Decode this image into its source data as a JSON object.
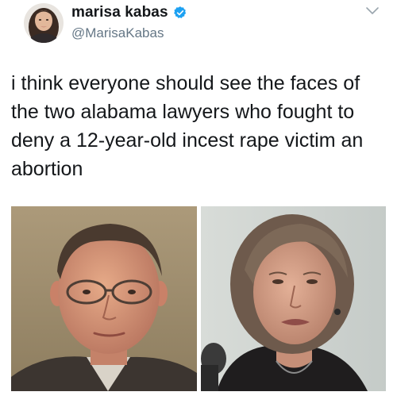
{
  "author": {
    "display_name": "marisa kabas",
    "handle": "@MarisaKabas",
    "verified": true,
    "verified_color": "#1da1f2"
  },
  "menu_icon": "chevron-down-icon",
  "tweet": {
    "text": "i think everyone should see the faces of the two alabama lawyers who fought to deny a 12-year-old incest rape victim an abortion"
  },
  "media": {
    "photo_count": 2
  }
}
